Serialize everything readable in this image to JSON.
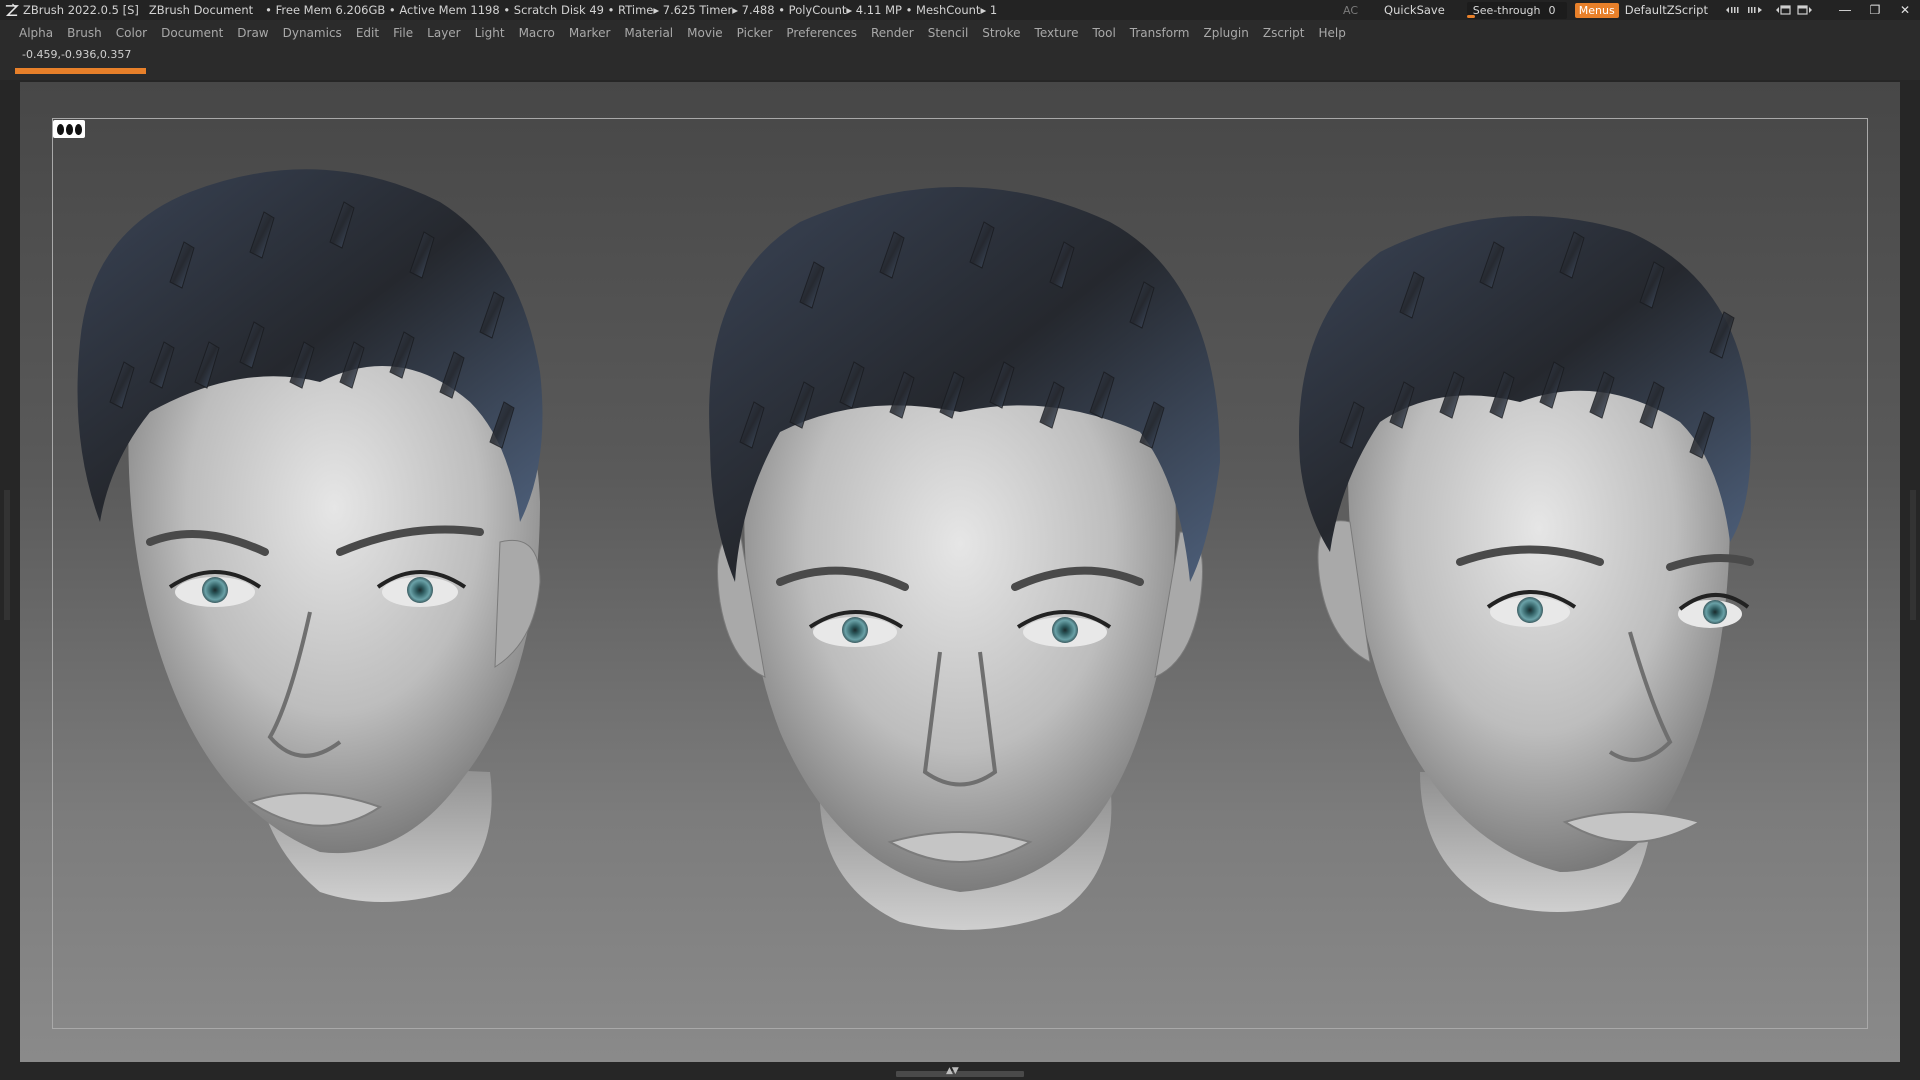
{
  "titlebar": {
    "app_version": "ZBrush 2022.0.5 [S]",
    "document": "ZBrush Document",
    "stats": "• Free Mem 6.206GB • Active Mem 1198 • Scratch Disk 49 •   RTime▸ 7.625 Timer▸ 7.488 • PolyCount▸ 4.11 MP  • MeshCount▸ 1",
    "ac_label": "AC",
    "quicksave": "QuickSave",
    "seethrough_label": "See-through",
    "seethrough_value": "0",
    "seethrough_level": 0.05,
    "menus_button": "Menus",
    "script_name": "DefaultZScript",
    "icons": [
      "shelf-left-icon",
      "shelf-right-icon",
      "window-layout-icon",
      "window-layout-alt-icon"
    ],
    "window_controls": [
      "minimize-icon",
      "restore-icon",
      "close-icon"
    ]
  },
  "menubar": {
    "items": [
      "Alpha",
      "Brush",
      "Color",
      "Document",
      "Draw",
      "Dynamics",
      "Edit",
      "File",
      "Layer",
      "Light",
      "Macro",
      "Marker",
      "Material",
      "Movie",
      "Picker",
      "Preferences",
      "Render",
      "Stencil",
      "Stroke",
      "Texture",
      "Tool",
      "Transform",
      "Zplugin",
      "Zscript",
      "Help"
    ]
  },
  "info": {
    "coordinates": "-0.459,-0.936,0.357",
    "progress_fraction": 1.0
  },
  "canvas": {
    "floor_icon": "floor-grid-icon",
    "heads": [
      "head-left-three-quarter",
      "head-front",
      "head-right-three-quarter"
    ]
  },
  "colors": {
    "accent": "#e8802a",
    "titlebar": "#232323",
    "menubar": "#2b2b2b",
    "hair_dark": "#2c2f35",
    "hair_blue": "#4d5f7a",
    "skin_light": "#d6d6d6",
    "skin_dark": "#7a7a7a",
    "eye": "#6aa2a8"
  }
}
